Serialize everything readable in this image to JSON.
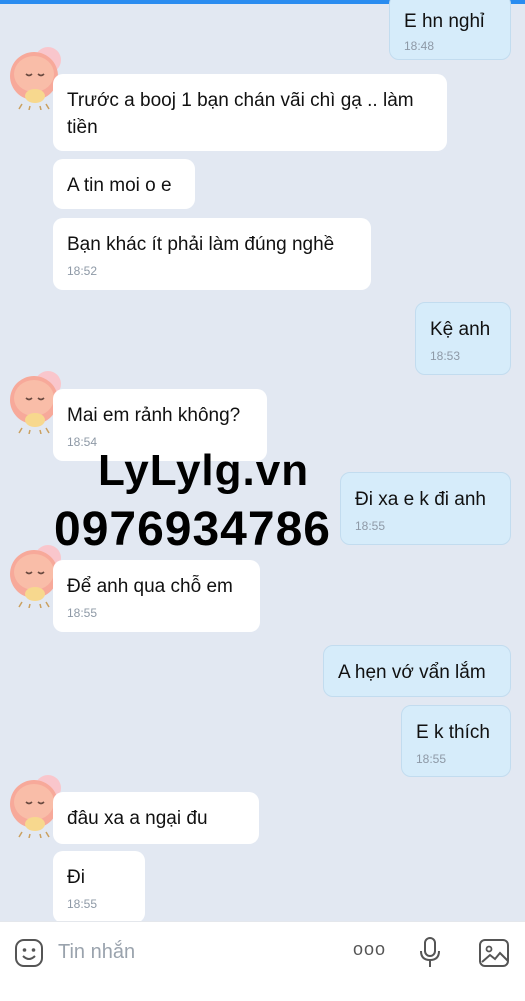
{
  "chat": {
    "messages": [
      {
        "dir": "out",
        "text": "E hn nghỉ",
        "time": "18:48"
      },
      {
        "dir": "in",
        "text": "Trước a booj 1 bạn chán vãi chì gạ .. làm\ntiền",
        "time": ""
      },
      {
        "dir": "in",
        "text": "A tin moi o e",
        "time": ""
      },
      {
        "dir": "in",
        "text": "Bạn khác ít phải làm đúng nghề",
        "time": "18:52"
      },
      {
        "dir": "out",
        "text": "Kệ anh",
        "time": "18:53"
      },
      {
        "dir": "in",
        "text": "Mai em rảnh không?",
        "time": "18:54"
      },
      {
        "dir": "out",
        "text": "Đi xa e k đi anh",
        "time": "18:55"
      },
      {
        "dir": "in",
        "text": "Để anh qua chỗ em",
        "time": "18:55"
      },
      {
        "dir": "out",
        "text": "A hẹn vớ vẩn lắm",
        "time": ""
      },
      {
        "dir": "out",
        "text": "E k thích",
        "time": "18:55"
      },
      {
        "dir": "in",
        "text": "đâu xa a ngại đu",
        "time": ""
      },
      {
        "dir": "in",
        "text": "Đi",
        "time": "18:55"
      }
    ]
  },
  "watermark": {
    "line1": "LyLylg.vn",
    "line2": "0976934786"
  },
  "input": {
    "placeholder": "Tin nhắn",
    "more": "ooo"
  },
  "icons": {
    "emoji": "emoji-icon",
    "mic": "microphone-icon",
    "image": "image-icon",
    "avatar": "avatar"
  },
  "colors": {
    "incoming": "#ffffff",
    "outgoing": "#d6ecfa",
    "background": "#e2e8f2",
    "accent": "#2a8cf0"
  }
}
